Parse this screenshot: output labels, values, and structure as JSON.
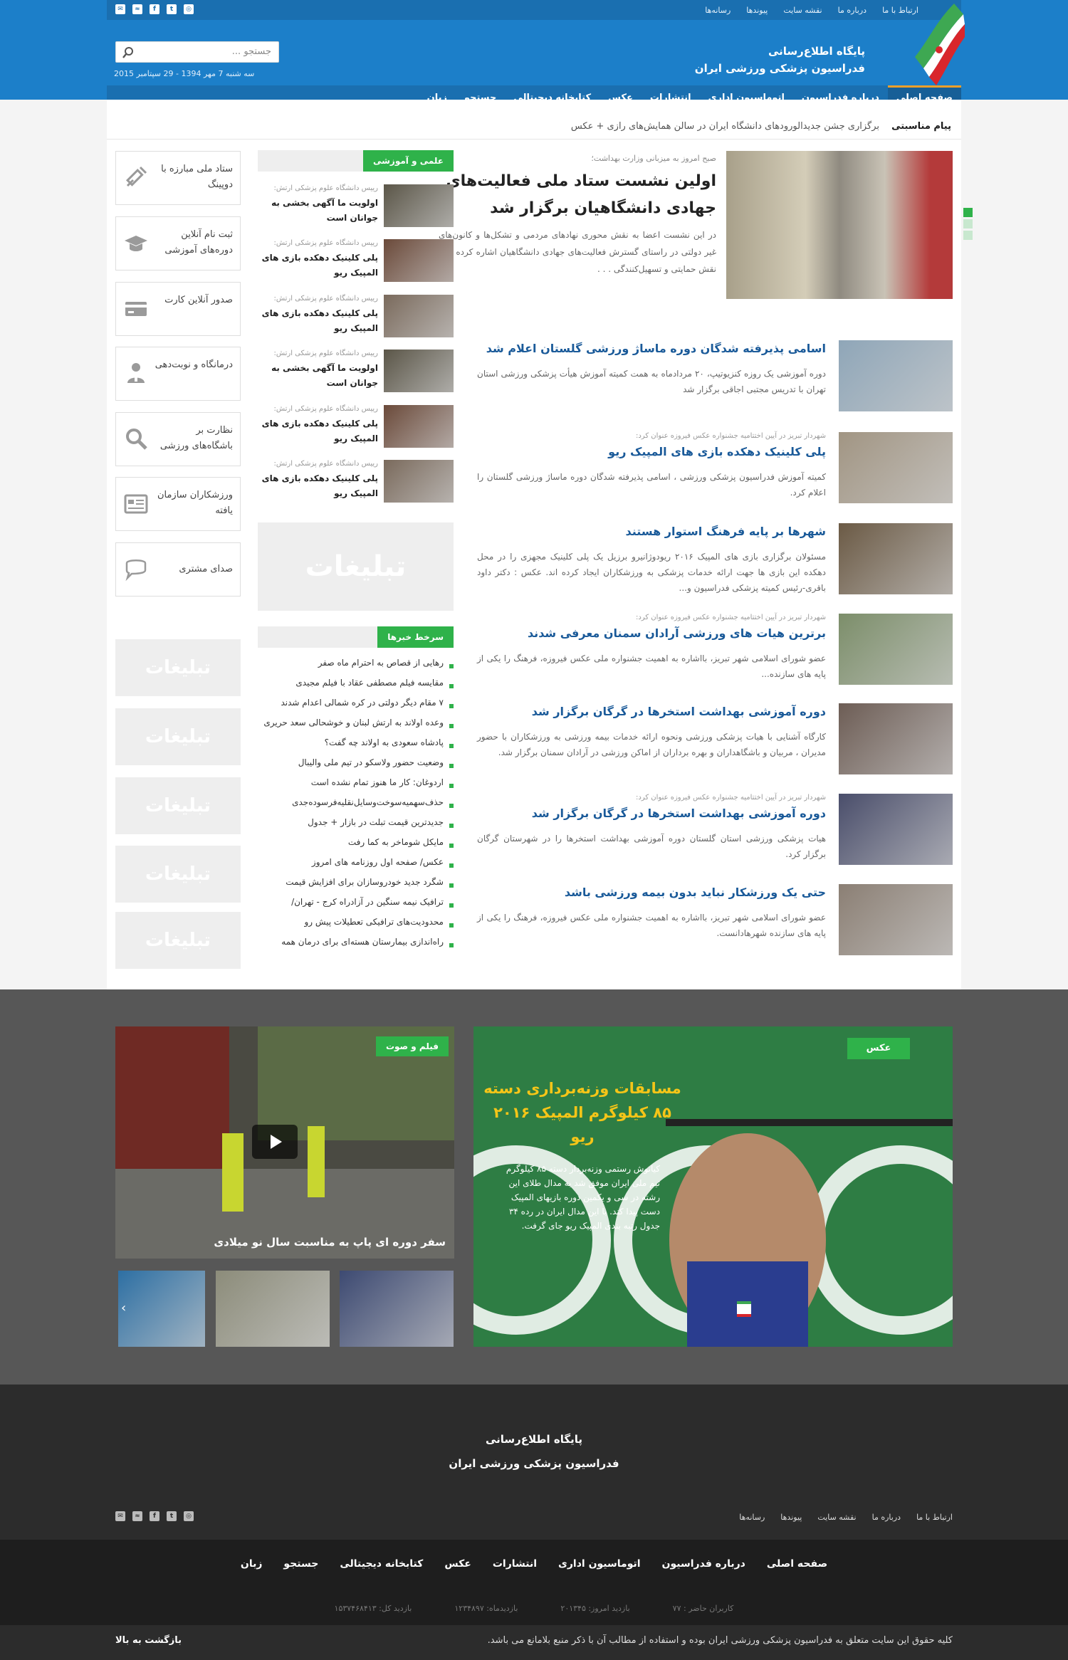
{
  "topbar": {
    "links": [
      "ارتباط با ما",
      "درباره ما",
      "نقشه سایت",
      "پیوندها",
      "رسانه‌ها"
    ],
    "social_icons": [
      "mail-icon",
      "rss-icon",
      "facebook-icon",
      "twitter-icon",
      "instagram-icon"
    ]
  },
  "header": {
    "title_line1": "پایگاه اطلاع‌رسانی",
    "title_line2": "فدراسیون پزشکی ورزشی ایران",
    "search_placeholder": "جستجو ...",
    "date": "سه شنبه 7 مهر 1394 - 29 سپتامبر 2015"
  },
  "nav": {
    "items": [
      "صفحه اصلی",
      "درباره فدراسیون",
      "اتوماسیون اداری",
      "انتشارات",
      "عکس",
      "کتابخانه دیجیتالی",
      "جستجو",
      "زبان"
    ],
    "active": "صفحه اصلی"
  },
  "ticker": {
    "label": "پیام مناسبتی",
    "text": "برگزاری جشن جدیدالورودهای دانشگاه ایران در سالن همایش‌های رازی + عکس"
  },
  "lead": {
    "kicker": "صبح امروز به میزبانی وزارت بهداشت؛",
    "title": "اولین نشست ستاد ملی فعالیت‌های جهادی دانشگاهیان برگزار شد",
    "text": "در این نشست اعضا به نقش محوری نهادهای مردمی و تشکل‌ها و کانون‌های غیر دولتی در راستای گسترش فعالیت‌های جهادی دانشگاهیان اشاره کرده و بر نقش حمایتی و تسهیل‌کنندگی . . ."
  },
  "news": [
    {
      "kicker": "",
      "title": "اسامی پذیرفته شدگان دوره ماساژ ورزشی گلستان اعلام شد",
      "text": "دوره آموزشی یک روزه کنزیوتیپ، ۲۰ مردادماه به همت کمیته آموزش هیأت پزشکی ورزشی استان تهران با تدریس مجتبی اجاقی برگزار شد",
      "img_color": "#8fa6b8"
    },
    {
      "kicker": "شهردار تبریز در آیین اختتامیه جشنواره عکس فیروزه عنوان کرد:",
      "title": "پلی کلینیک دهکده بازی های المپیک ریو",
      "text": "کمیته آموزش فدراسیون پزشکی ورزشی ، اسامی پذیرفته شدگان دوره ماساژ ورزشی گلستان را اعلام کرد.",
      "img_color": "#a19583"
    },
    {
      "kicker": "",
      "title": "شهرها بر پایه فرهنگ استوار هستند",
      "text": "مسئولان برگزاری بازی های المپیک ۲۰۱۶ ریودوژانیرو برزیل یک پلی کلینیک مجهزی را در محل دهکده این بازی ها جهت ارائه خدمات پزشکی به ورزشکاران ایجاد کرده اند. عکس : دکتر داود باقری-رئیس کمیته پزشکی فدراسیون و...",
      "img_color": "#6b5a45"
    },
    {
      "kicker": "شهردار تبریز در آیین اختتامیه جشنواره عکس فیروزه عنوان کرد:",
      "title": "برترین هیات های ورزشی آرادان سمنان معرفی شدند",
      "text": "عضو شورای اسلامی شهر تبریز، بااشاره به اهمیت جشنواره ملی عکس فیروزه، فرهنگ را یکی از پایه های سازنده...",
      "img_color": "#7c8e6a"
    },
    {
      "kicker": "",
      "title": "دوره آموزشی بهداشت استخرها در گرگان برگزار شد",
      "text": "کارگاه آشنایی با هیات پزشکی ورزشی ونحوه ارائه خدمات بیمه ورزشی به ورزشکاران با حضور مدیران ، مربیان و باشگاهداران و بهره برداران از اماکن ورزشی در آرادان سمنان برگزار شد.",
      "img_color": "#6d5d55"
    },
    {
      "kicker": "شهردار تبریز در آیین اختتامیه جشنواره عکس فیروزه عنوان کرد:",
      "title": "دوره آموزشی بهداشت استخرها در گرگان برگزار شد",
      "text": "هیات پزشکی ورزشی استان گلستان دوره آموزشی بهداشت استخرها را در شهرستان گرگان برگزار کرد.",
      "img_color": "#4a4e6b"
    },
    {
      "kicker": "",
      "title": "حتی یک ورزشکار نباید بدون بیمه ورزشی باشد",
      "text": "عضو شورای اسلامی شهر تبریز، بااشاره به اهمیت جشنواره ملی عکس فیروزه، فرهنگ را یکی از پایه های سازنده شهرهادانست.",
      "img_color": "#8b7f74"
    }
  ],
  "science": {
    "heading": "علمی و آموزشی",
    "items": [
      {
        "kicker": "رییس دانشگاه علوم پزشکی ارتش:",
        "title": "اولویت ما آگهی بخشی به جوانان است",
        "img_color": "#5b5648"
      },
      {
        "kicker": "رییس دانشگاه علوم پزشکی ارتش:",
        "title": "پلی کلینیک دهکده بازی های المپیک ریو",
        "img_color": "#6b4a3a"
      },
      {
        "kicker": "رییس دانشگاه علوم پزشکی ارتش:",
        "title": "پلی کلینیک دهکده بازی های المپیک ریو",
        "img_color": "#7a6a5c"
      },
      {
        "kicker": "رییس دانشگاه علوم پزشکی ارتش:",
        "title": "اولویت ما آگهی بخشی به جوانان است",
        "img_color": "#5b5648"
      },
      {
        "kicker": "رییس دانشگاه علوم پزشکی ارتش:",
        "title": "پلی کلینیک دهکده بازی های المپیک ریو",
        "img_color": "#6b4a3a"
      },
      {
        "kicker": "رییس دانشگاه علوم پزشکی ارتش:",
        "title": "پلی کلینیک دهکده بازی های المپیک ریو",
        "img_color": "#7a6a5c"
      }
    ]
  },
  "ads_label": "تبلیغات",
  "headlines": {
    "heading": "سرخط خبرها",
    "items": [
      "رهایی از قصاص به احترام ماه صفر",
      "مقایسه فیلم مصطفی عقاد با فیلم مجیدی",
      "۷ مقام دیگر دولتی در کره شمالی اعدام شدند",
      "وعده اولاند به ارتش لبنان و خوشحالی سعد حریری",
      "پادشاه سعودی به اولاند چه گفت؟",
      "وضعیت حضور ولاسکو در تیم ملی والیبال",
      "اردوغان: کار ما هنوز تمام نشده است",
      "حذف‌سهمیه‌سوخت‌وسایل‌نقلیه‌فرسوده‌جدی",
      "جدیدترین قیمت تبلت در بازار + جدول",
      "مایکل شوماخر به کما رفت",
      "عکس/ صفحه اول روزنامه های امروز",
      "شگرد جدید خودروسازان برای افزایش قیمت",
      "ترافیک نیمه سنگین در آزادراه کرج - تهران/",
      "محدودیت‌های ترافیکی تعطیلات پیش رو",
      "راه‌اندازی بیمارستان هسته‌ای برای درمان همه"
    ]
  },
  "quicklinks": [
    {
      "label": "ستاد ملی مبارزه با دوپینگ",
      "icon": "syringe-icon"
    },
    {
      "label": "ثبت نام آنلاین دوره‌های آموزشی",
      "icon": "graduation-cap-icon"
    },
    {
      "label": "صدور آنلاین کارت",
      "icon": "credit-card-icon"
    },
    {
      "label": "درمانگاه و نوبت‌دهی",
      "icon": "doctor-icon"
    },
    {
      "label": "نظارت بر باشگاه‌های ورزشی",
      "icon": "magnifier-icon"
    },
    {
      "label": "ورزشکاران سازمان یافته",
      "icon": "id-card-icon"
    },
    {
      "label": "صدای مشتری",
      "icon": "speech-bubble-icon"
    }
  ],
  "media": {
    "photo_label": "عکس",
    "photo_title": "مسابقات وزنه‌برداری دسته ۸۵ کیلوگرم المپیک ۲۰۱۶ ریو",
    "photo_text": "کیانوش رستمی وزنه‌بردار دسته ۸۵ کیلوگرم تیم ملی ایران موفق شد به مدال طلای این رشته در سی و یکمین دوره بازیهای المپیک دست پیدا کند. با این مدال ایران در رده ۳۴ جدول رتبه بندی المپیک ریو جای گرفت.",
    "video_label": "فیلم و صوت",
    "video_caption": "سفر دوره ای پاپ به مناسبت سال نو میلادی",
    "thumbs": [
      {
        "color": "#2d6fa3"
      },
      {
        "color": "#8c8c7a"
      },
      {
        "color": "#3d4a72"
      }
    ]
  },
  "footer": {
    "title_line1": "پایگاه اطلاع‌رسانی",
    "title_line2": "فدراسیون پزشکی ورزشی ایران",
    "links": [
      "ارتباط با ما",
      "درباره ما",
      "نقشه سایت",
      "پیوندها",
      "رسانه‌ها"
    ],
    "nav": [
      "صفحه اصلی",
      "درباره فدراسیون",
      "اتوماسیون اداری",
      "انتشارات",
      "عکس",
      "کتابخانه دیجیتالی",
      "جستجو",
      "زبان"
    ],
    "stats": [
      "کاربران حاضر : ۷۷",
      "بازدید امروز: ۲۰۱۳۴۵",
      "بازدیدماه: ۱۲۳۴۸۹۷",
      "بازدید کل: ۱۵۳۷۴۶۸۴۱۳"
    ],
    "copyright": "کلیه حقوق این سایت متعلق به فدراسیون پزشکی ورزشی ایران بوده و استفاده از مطالب آن با ذکر منبع بلامانع می باشد.",
    "back_to_top": "بازگشت به بالا"
  }
}
